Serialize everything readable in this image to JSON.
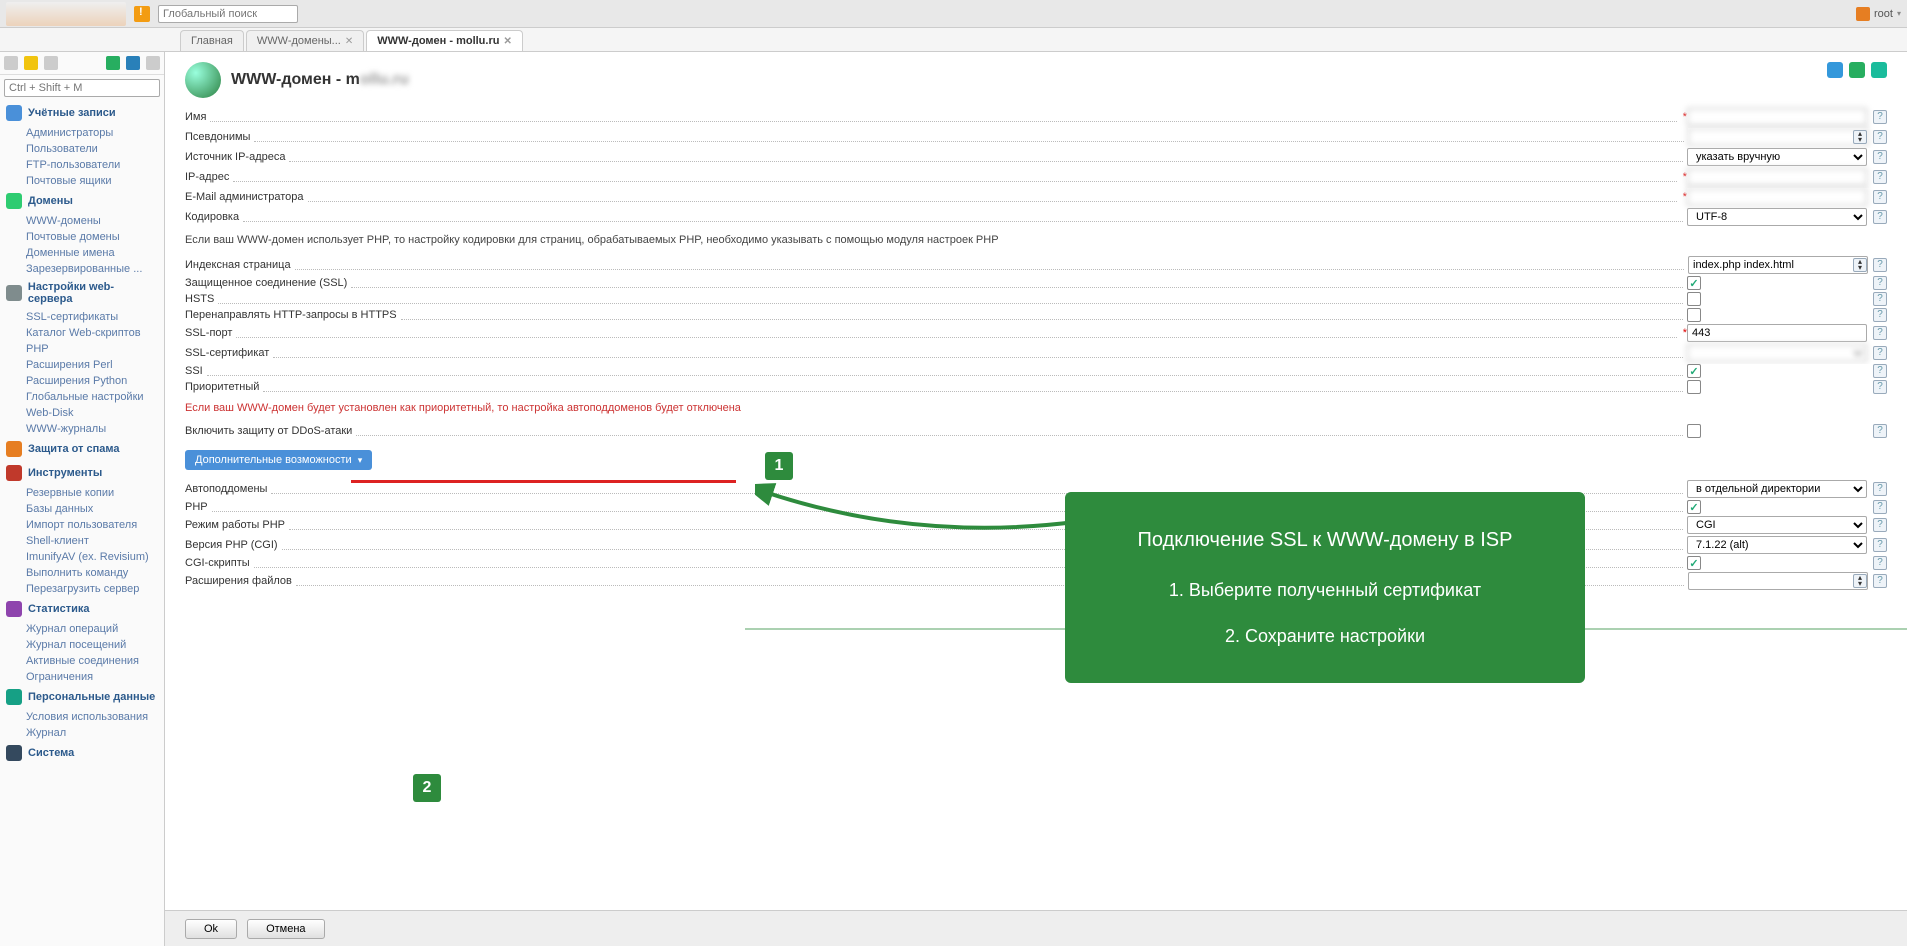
{
  "topbar": {
    "global_search_placeholder": "Глобальный поиск",
    "user": "root"
  },
  "tabs": {
    "main": "Главная",
    "www_list": "WWW-домены...",
    "www_edit": "WWW-домен - mollu.ru"
  },
  "sidebar": {
    "search_placeholder": "Ctrl + Shift + M",
    "groups": {
      "accounts": {
        "title": "Учётные записи",
        "items": [
          "Администраторы",
          "Пользователи",
          "FTP-пользователи",
          "Почтовые ящики"
        ]
      },
      "domains": {
        "title": "Домены",
        "items": [
          "WWW-домены",
          "Почтовые домены",
          "Доменные имена",
          "Зарезервированные ..."
        ]
      },
      "webserver": {
        "title": "Настройки web-сервера",
        "items": [
          "SSL-сертификаты",
          "Каталог Web-скриптов",
          "PHP",
          "Расширения Perl",
          "Расширения Python",
          "Глобальные настройки",
          "Web-Disk",
          "WWW-журналы"
        ]
      },
      "spam": {
        "title": "Защита от спама",
        "items": []
      },
      "tools": {
        "title": "Инструменты",
        "items": [
          "Резервные копии",
          "Базы данных",
          "Импорт пользователя",
          "Shell-клиент",
          "ImunifyAV (ex. Revisium)",
          "Выполнить команду",
          "Перезагрузить сервер"
        ]
      },
      "stats": {
        "title": "Статистика",
        "items": [
          "Журнал операций",
          "Журнал посещений",
          "Активные соединения",
          "Ограничения"
        ]
      },
      "personal": {
        "title": "Персональные данные",
        "items": [
          "Условия использования",
          "Журнал"
        ]
      },
      "system": {
        "title": "Система",
        "items": []
      }
    }
  },
  "page": {
    "title": "WWW-домен - m"
  },
  "form": {
    "name": {
      "label": "Имя",
      "required": true,
      "value": ""
    },
    "aliases": {
      "label": "Псевдонимы",
      "value": ""
    },
    "ip_src": {
      "label": "Источник IP-адреса",
      "value": "указать вручную"
    },
    "ip": {
      "label": "IP-адрес",
      "required": true,
      "value": ""
    },
    "email": {
      "label": "E-Mail администратора",
      "required": true,
      "value": ""
    },
    "charset": {
      "label": "Кодировка",
      "value": "UTF-8"
    },
    "charset_note": "Если ваш WWW-домен использует PHP, то настройку кодировки для страниц, обрабатываемых PHP, необходимо указывать с помощью модуля настроек PHP",
    "index": {
      "label": "Индексная страница",
      "value": "index.php index.html"
    },
    "ssl": {
      "label": "Защищенное соединение (SSL)",
      "checked": true
    },
    "hsts": {
      "label": "HSTS",
      "checked": false
    },
    "https_redirect": {
      "label": "Перенаправлять HTTP-запросы в HTTPS",
      "checked": false
    },
    "ssl_port": {
      "label": "SSL-порт",
      "required": true,
      "value": "443"
    },
    "ssl_cert": {
      "label": "SSL-сертификат",
      "value": ""
    },
    "ssi": {
      "label": "SSI",
      "checked": true
    },
    "priority": {
      "label": "Приоритетный",
      "checked": false
    },
    "priority_note": "Если ваш WWW-домен будет установлен как приоритетный, то настройка автоподдоменов будет отключена",
    "ddos": {
      "label": "Включить защиту от DDoS-атаки",
      "checked": false
    },
    "section2": "Дополнительные возможности",
    "autosub": {
      "label": "Автоподдомены",
      "value": "в отдельной директории"
    },
    "php": {
      "label": "PHP",
      "checked": true
    },
    "php_mode": {
      "label": "Режим работы PHP",
      "value": "CGI"
    },
    "php_ver": {
      "label": "Версия PHP (CGI)",
      "value": "7.1.22 (alt)"
    },
    "cgi": {
      "label": "CGI-скрипты",
      "checked": true
    },
    "ext": {
      "label": "Расширения файлов",
      "value": ""
    }
  },
  "buttons": {
    "ok": "Ok",
    "cancel": "Отмена"
  },
  "callout": {
    "title": "Подключение SSL к WWW-домену в ISP",
    "step1": "1. Выберите полученный сертификат",
    "step2": "2. Сохраните настройки"
  }
}
